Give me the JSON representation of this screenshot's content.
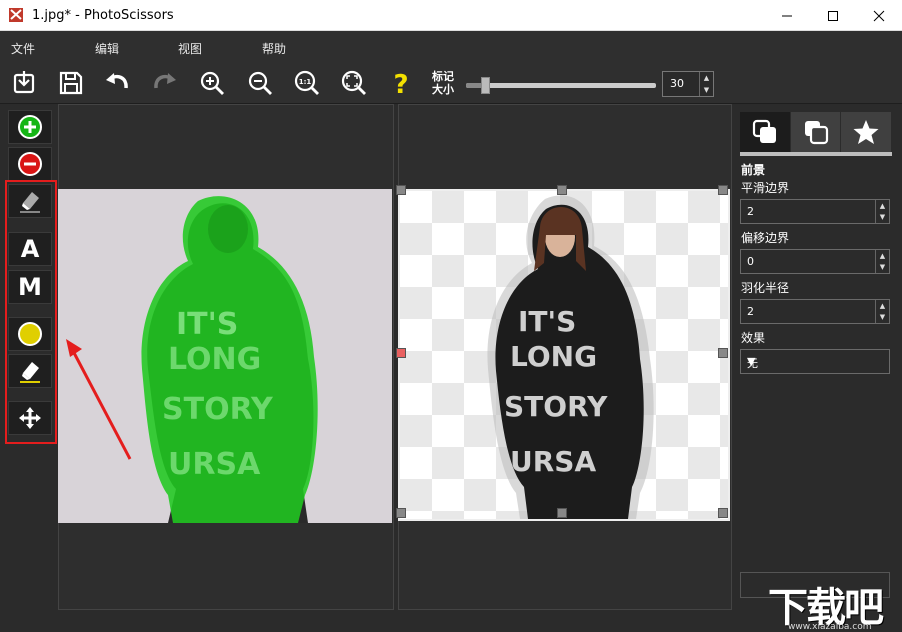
{
  "window": {
    "title": "1.jpg* - PhotoScissors"
  },
  "menu": [
    "文件",
    "编辑",
    "视图",
    "帮助"
  ],
  "toolbar": {
    "buttons": [
      "open-icon",
      "save-icon",
      "undo-icon",
      "redo-icon",
      "zoom-in-icon",
      "zoom-out-icon",
      "actual-size-icon",
      "fit-icon",
      "help-icon"
    ],
    "mark_size_label": [
      "标记",
      "大小"
    ],
    "mark_size_value": "30",
    "mark_size_fraction": 0.1
  },
  "left_tools": [
    "foreground-marker",
    "background-marker",
    "eraser",
    "auto-mode",
    "manual-mode",
    "hair-marker",
    "hair-eraser",
    "move"
  ],
  "left_tool_letters": {
    "auto": "A",
    "manual": "M"
  },
  "right_panel": {
    "tabs": [
      "foreground-tab",
      "background-tab",
      "effects-tab"
    ],
    "section_title": "前景",
    "smooth_edge_label": "平滑边界",
    "smooth_edge_value": "2",
    "offset_edge_label": "偏移边界",
    "offset_edge_value": "0",
    "feather_radius_label": "羽化半径",
    "feather_radius_value": "2",
    "effect_label": "效果",
    "effect_value": "无"
  },
  "shirt_text": [
    "IT'S",
    "LONG",
    "STORY",
    "URSA"
  ],
  "colors": {
    "accent_red": "#e41d1d",
    "foreground_green": "#1fc91f",
    "panel_bg": "#2b2b2b",
    "marker_yellow": "#f3e000"
  },
  "watermark": {
    "big": "下载吧",
    "small": "www.xiazaiba.com"
  }
}
